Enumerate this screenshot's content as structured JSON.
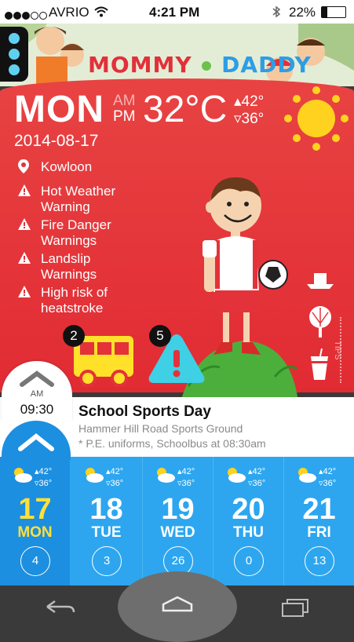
{
  "status_bar": {
    "carrier": "AVRIO",
    "time": "4:21 PM",
    "battery": "22%"
  },
  "header": {
    "logo_word1": "MOMMY",
    "logo_word2": "DADDY"
  },
  "today": {
    "day": "MON",
    "ampm_top": "AM",
    "ampm_bottom": "PM",
    "temperature": "32°C",
    "high": "42°",
    "low": "36°",
    "date": "2014-08-17",
    "location": "Kowloon",
    "warnings": [
      {
        "line1": "Hot Weather",
        "line2": "Warning"
      },
      {
        "line1": "Fire Danger",
        "line2": "Warnings"
      },
      {
        "line1": "Landslip",
        "line2": "Warnings"
      },
      {
        "line1": "High risk of",
        "line2": "heatstroke"
      }
    ],
    "tips_label": "TIPS"
  },
  "badges": {
    "bus_count": "2",
    "alert_count": "5"
  },
  "schedule": {
    "time_period": "AM",
    "time": "09:30",
    "title": "School Sports Day",
    "location": "Hammer Hill Road Sports Ground",
    "note": "* P.E. uniforms, Schoolbus at 08:30am"
  },
  "forecast": [
    {
      "num": "17",
      "name": "MON",
      "high": "42°",
      "low": "36°",
      "count": "4"
    },
    {
      "num": "18",
      "name": "TUE",
      "high": "42°",
      "low": "36°",
      "count": "3"
    },
    {
      "num": "19",
      "name": "WED",
      "high": "42°",
      "low": "36°",
      "count": "26"
    },
    {
      "num": "20",
      "name": "THU",
      "high": "42°",
      "low": "36°",
      "count": "0"
    },
    {
      "num": "21",
      "name": "FRI",
      "high": "42°",
      "low": "36°",
      "count": "13"
    }
  ],
  "colors": {
    "red": "#e3323a",
    "blue": "#2da6ef",
    "dark_blue": "#1d8fe0",
    "sun": "#ffd21f",
    "today_yellow": "#ffe03a",
    "bus_yellow": "#ffe12a",
    "alert_cyan": "#3fd0e6"
  }
}
